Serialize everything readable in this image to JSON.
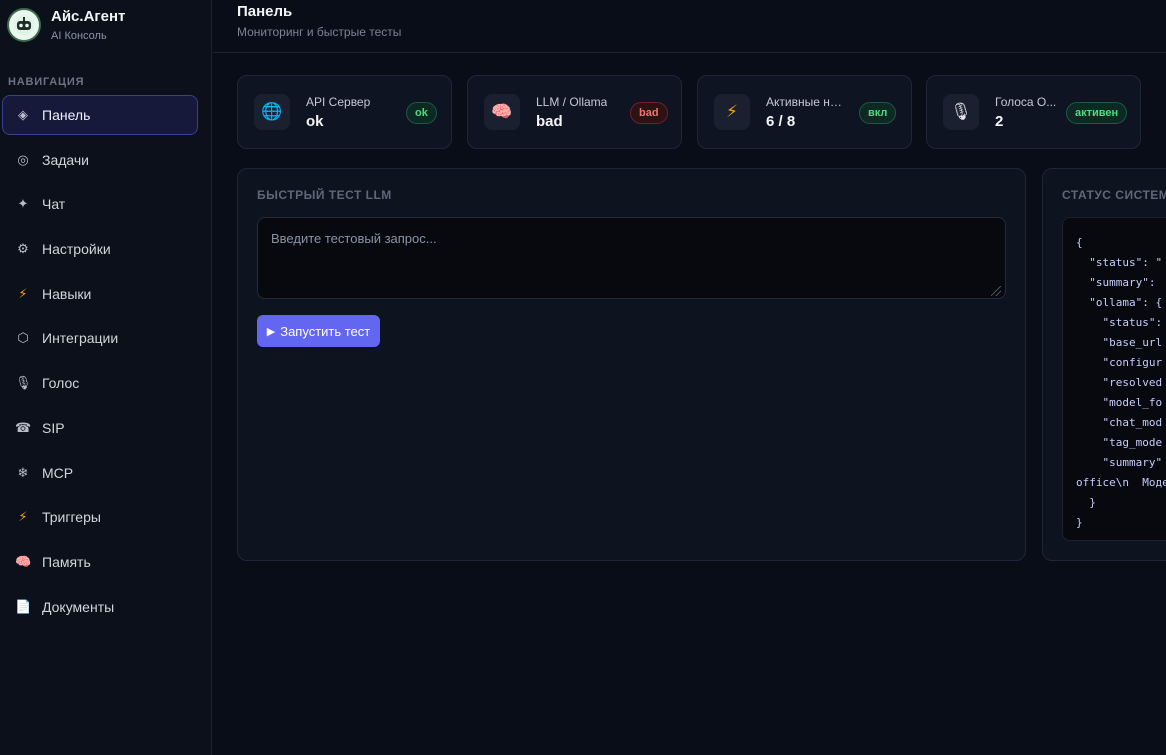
{
  "brand": {
    "name": "Айс.Агент",
    "subtitle": "AI Консоль"
  },
  "nav": {
    "heading": "НАВИГАЦИЯ",
    "items": [
      {
        "label": "Панель",
        "icon": "diamond-icon",
        "glyph": "◈",
        "active": true
      },
      {
        "label": "Задачи",
        "icon": "target-icon",
        "glyph": "◎"
      },
      {
        "label": "Чат",
        "icon": "sparkle-icon",
        "glyph": "✦"
      },
      {
        "label": "Настройки",
        "icon": "gear-icon",
        "glyph": "⚙"
      },
      {
        "label": "Навыки",
        "icon": "lightning-icon",
        "glyph": "⚡"
      },
      {
        "label": "Интеграции",
        "icon": "hexagon-icon",
        "glyph": "⬡"
      },
      {
        "label": "Голос",
        "icon": "microphone-icon",
        "glyph": "🎙"
      },
      {
        "label": "SIP",
        "icon": "telephone-icon",
        "glyph": "☎"
      },
      {
        "label": "MCP",
        "icon": "snowflake-icon",
        "glyph": "❄"
      },
      {
        "label": "Триггеры",
        "icon": "lightning-icon",
        "glyph": "⚡"
      },
      {
        "label": "Память",
        "icon": "brain-icon",
        "glyph": "🧠"
      },
      {
        "label": "Документы",
        "icon": "document-icon",
        "glyph": "📄"
      }
    ]
  },
  "header": {
    "title": "Панель",
    "subtitle": "Мониторинг и быстрые тесты"
  },
  "stats": [
    {
      "label": "API Сервер",
      "value": "ok",
      "badge": "ok",
      "badge_type": "ok",
      "icon": "globe-icon",
      "glyph": "🌐"
    },
    {
      "label": "LLM / Ollama",
      "value": "bad",
      "badge": "bad",
      "badge_type": "bad",
      "icon": "brain-icon",
      "glyph": "🧠"
    },
    {
      "label": "Активные на...",
      "value": "6 / 8",
      "badge": "вкл",
      "badge_type": "ok",
      "icon": "lightning-icon",
      "glyph": "⚡"
    },
    {
      "label": "Голоса О...",
      "value": "2",
      "badge": "активен",
      "badge_type": "ok",
      "icon": "microphone-icon",
      "glyph": "🎙"
    }
  ],
  "llm_test": {
    "title": "БЫСТРЫЙ ТЕСТ LLM",
    "placeholder": "Введите тестовый запрос...",
    "run_label": "Запустить тест"
  },
  "system_status": {
    "title": "СТАТУС СИСТЕМ",
    "json_lines": [
      "{",
      "  \"status\": \"",
      "  \"summary\": ",
      "  \"ollama\": {",
      "    \"status\":",
      "    \"base_url",
      "    \"configur",
      "    \"resolved",
      "    \"model_fo",
      "    \"chat_mod",
      "    \"tag_mode",
      "    \"summary\"",
      "office\\n  Моде",
      "  }",
      "}"
    ]
  },
  "colors": {
    "accent": "#6366f1",
    "ok": "#4ade80",
    "bad": "#f87171",
    "background": "#090d17"
  }
}
